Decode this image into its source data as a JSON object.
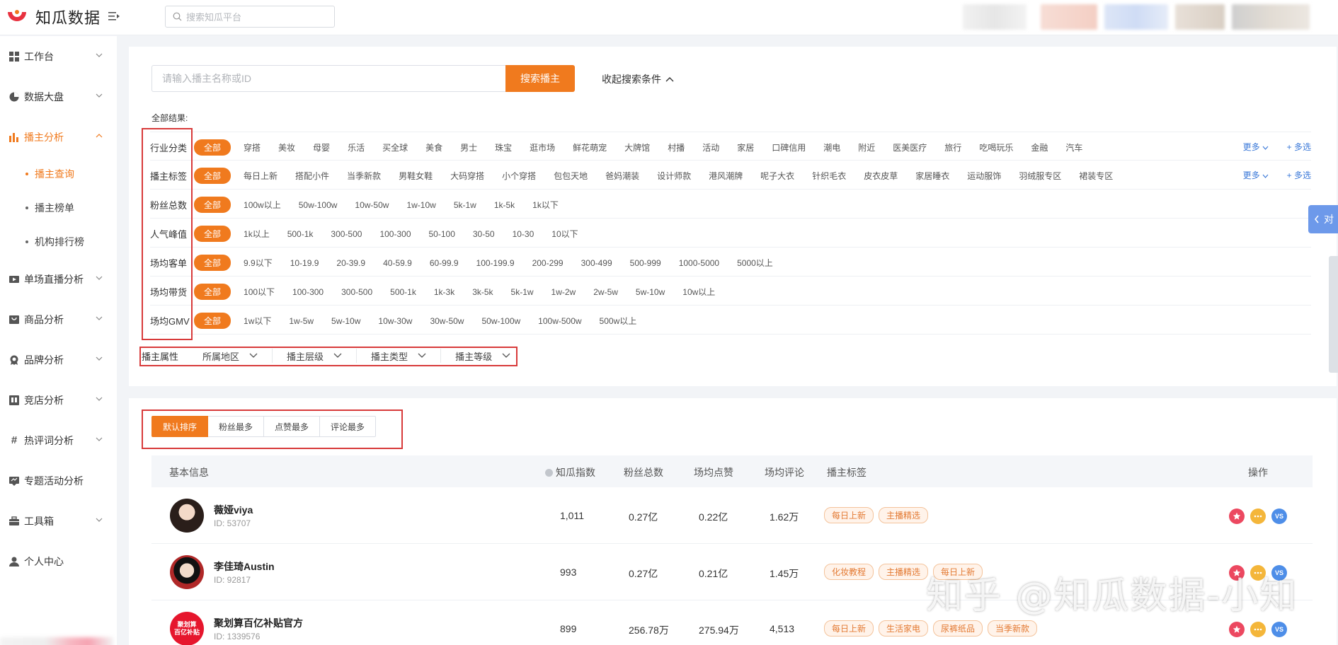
{
  "app": {
    "name": "知瓜数据"
  },
  "topbar": {
    "search_placeholder": "搜索知瓜平台"
  },
  "sidebar": {
    "items": [
      {
        "label": "工作台",
        "icon": "grid-icon"
      },
      {
        "label": "数据大盘",
        "icon": "pie-chart-icon"
      },
      {
        "label": "播主分析",
        "icon": "bar-chart-icon",
        "active": true
      },
      {
        "label": "单场直播分析",
        "icon": "video-icon"
      },
      {
        "label": "商品分析",
        "icon": "shop-icon"
      },
      {
        "label": "品牌分析",
        "icon": "badge-icon"
      },
      {
        "label": "竞店分析",
        "icon": "store-icon"
      },
      {
        "label": "热评词分析",
        "icon": "hashtag-icon"
      },
      {
        "label": "专题活动分析",
        "icon": "message-icon"
      },
      {
        "label": "工具箱",
        "icon": "toolbox-icon"
      },
      {
        "label": "个人中心",
        "icon": "user-icon"
      }
    ],
    "sub_items": [
      {
        "label": "播主查询",
        "active": true
      },
      {
        "label": "播主榜单"
      },
      {
        "label": "机构排行榜"
      }
    ]
  },
  "filter": {
    "search_placeholder": "请输入播主名称或ID",
    "search_button": "搜索播主",
    "collapse_label": "收起搜索条件",
    "all_results_label": "全部结果:",
    "more_label": "更多",
    "multi_label": "+ 多选",
    "rows": [
      {
        "label": "行业分类",
        "options": [
          "全部",
          "穿搭",
          "美妆",
          "母婴",
          "乐活",
          "买全球",
          "美食",
          "男士",
          "珠宝",
          "逛市场",
          "鲜花萌宠",
          "大牌馆",
          "村播",
          "活动",
          "家居",
          "口碑信用",
          "潮电",
          "附近",
          "医美医疗",
          "旅行",
          "吃喝玩乐",
          "金融",
          "汽车"
        ]
      },
      {
        "label": "播主标签",
        "options": [
          "全部",
          "每日上新",
          "搭配小件",
          "当季新款",
          "男鞋女鞋",
          "大码穿搭",
          "小个穿搭",
          "包包天地",
          "爸妈潮装",
          "设计师款",
          "港风潮牌",
          "呢子大衣",
          "针织毛衣",
          "皮衣皮草",
          "家居睡衣",
          "运动服饰",
          "羽绒服专区",
          "裙装专区"
        ]
      },
      {
        "label": "粉丝总数",
        "options": [
          "全部",
          "100w以上",
          "50w-100w",
          "10w-50w",
          "1w-10w",
          "5k-1w",
          "1k-5k",
          "1k以下"
        ]
      },
      {
        "label": "人气峰值",
        "options": [
          "全部",
          "1k以上",
          "500-1k",
          "300-500",
          "100-300",
          "50-100",
          "30-50",
          "10-30",
          "10以下"
        ]
      },
      {
        "label": "场均客单",
        "options": [
          "全部",
          "9.9以下",
          "10-19.9",
          "20-39.9",
          "40-59.9",
          "60-99.9",
          "100-199.9",
          "200-299",
          "300-499",
          "500-999",
          "1000-5000",
          "5000以上"
        ]
      },
      {
        "label": "场均带货",
        "options": [
          "全部",
          "100以下",
          "100-300",
          "300-500",
          "500-1k",
          "1k-3k",
          "3k-5k",
          "5k-1w",
          "1w-2w",
          "2w-5w",
          "5w-10w",
          "10w以上"
        ]
      },
      {
        "label": "场均GMV",
        "options": [
          "全部",
          "1w以下",
          "1w-5w",
          "5w-10w",
          "10w-30w",
          "30w-50w",
          "50w-100w",
          "100w-500w",
          "500w以上"
        ]
      }
    ],
    "attributes": {
      "label": "播主属性",
      "dropdowns": [
        "所属地区",
        "播主层级",
        "播主类型",
        "播主等级"
      ]
    }
  },
  "compare_tab": {
    "label": "对"
  },
  "results": {
    "sort_tabs": [
      "默认排序",
      "粉丝最多",
      "点赞最多",
      "评论最多"
    ],
    "columns": {
      "basic": "基本信息",
      "index": "知瓜指数",
      "fans": "粉丝总数",
      "likes": "场均点赞",
      "comments": "场均评论",
      "tags": "播主标签",
      "ops": "操作"
    },
    "rows": [
      {
        "name": "薇娅viya",
        "id": "ID:  53707",
        "index": "1,011",
        "fans": "0.27亿",
        "likes": "0.22亿",
        "comments": "1.62万",
        "tags": [
          "每日上新",
          "主播精选"
        ]
      },
      {
        "name": "李佳琦Austin",
        "id": "ID:  92817",
        "index": "993",
        "fans": "0.27亿",
        "likes": "0.21亿",
        "comments": "1.45万",
        "tags": [
          "化妆教程",
          "主播精选",
          "每日上新"
        ]
      },
      {
        "name": "聚划算百亿补贴官方",
        "id": "ID:  1339576",
        "index": "899",
        "fans": "256.78万",
        "likes": "275.94万",
        "comments": "4,513",
        "tags": [
          "每日上新",
          "生活家电",
          "尿裤纸品",
          "当季新款"
        ],
        "avatar_text": "聚划算\n百亿补贴"
      }
    ],
    "ops": {
      "vs_label": "VS"
    }
  },
  "watermark": "知乎 @知瓜数据-小知",
  "colors": {
    "accent": "#f07a1e",
    "link": "#3a78d8",
    "highlight_box": "#d83a3a"
  }
}
